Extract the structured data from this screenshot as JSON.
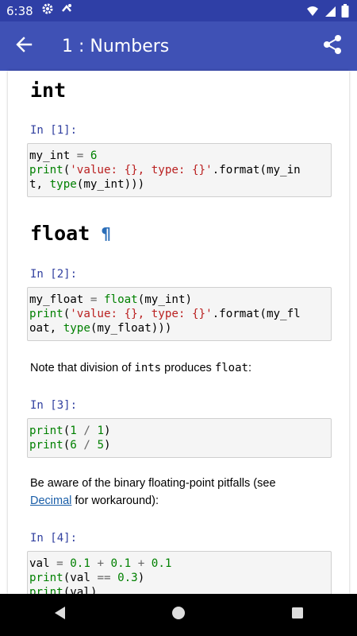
{
  "status_bar": {
    "time": "6:38"
  },
  "app_bar": {
    "title": "1 : Numbers"
  },
  "notebook": {
    "heading_int": "int",
    "prompt_1": "In [1]:",
    "heading_float": "float",
    "heading_float_anchor": "¶",
    "prompt_2": "In [2]:",
    "note_division_prefix": "Note that division of ",
    "note_division_code1": "ints",
    "note_division_middle": " produces ",
    "note_division_code2": "float",
    "note_division_suffix": ":",
    "prompt_3": "In [3]:",
    "pitfalls_line1": "Be aware of the binary floating-point pitfalls (see",
    "pitfalls_link": "Decimal",
    "pitfalls_line2_suffix": " for workaround):",
    "prompt_4": "In [4]:"
  },
  "colors": {
    "status_bar": "#2f3fa6",
    "app_bar": "#3f51b5",
    "prompt": "#303f9f",
    "keyword": "#008000",
    "string": "#ba2121",
    "link": "#1a5ea8"
  },
  "icons": {
    "status": [
      "settings-icon",
      "sync-icon",
      "wifi-icon",
      "signal-icon",
      "battery-icon"
    ],
    "app_bar": [
      "back-arrow-icon",
      "share-icon"
    ],
    "nav": [
      "back-triangle-icon",
      "home-circle-icon",
      "recents-square-icon"
    ]
  }
}
